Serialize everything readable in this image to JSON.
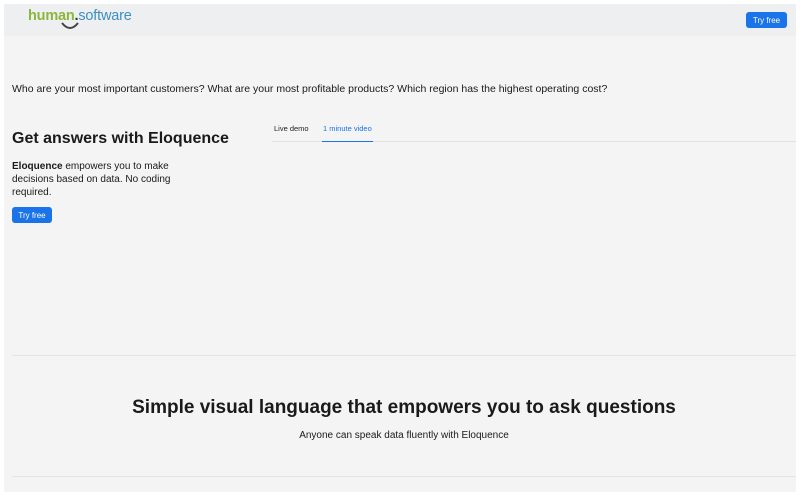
{
  "header": {
    "logo": {
      "human": "human",
      "dot": ".",
      "software": "software"
    },
    "cta_label": "Try free"
  },
  "hero": {
    "question": "Who are your most important customers? What are your most profitable products? Which region has the highest operating cost?",
    "title": "Get answers with Eloquence",
    "desc_brand": "Eloquence",
    "desc_rest": " empowers you to make decisions based on data. No coding required.",
    "cta_label": "Try free"
  },
  "tabs": [
    {
      "label": "Live demo",
      "active": false
    },
    {
      "label": "1 minute video",
      "active": true
    }
  ],
  "section": {
    "title": "Simple visual language that empowers you to ask questions",
    "subtitle": "Anyone can speak data fluently with Eloquence"
  },
  "colors": {
    "accent": "#1a73e8",
    "logo_green": "#8cb63c",
    "logo_blue": "#3d8fc4",
    "background": "#f4f4f5"
  }
}
